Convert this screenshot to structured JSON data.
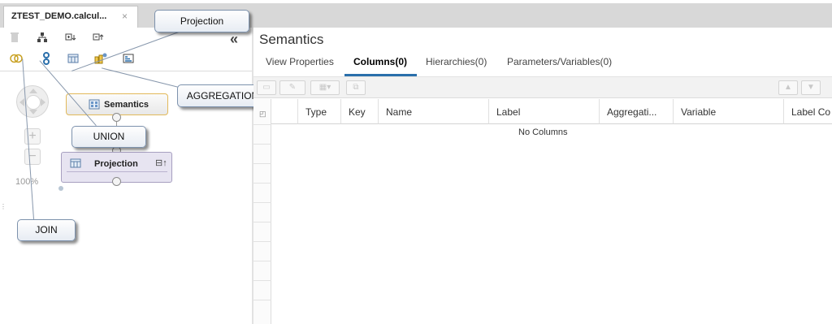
{
  "doc_tab": {
    "title": "ZTEST_DEMO.calcul...",
    "close": "×"
  },
  "left_toolbar": {
    "collapse_label": "«",
    "row1_icons": [
      "trash-icon",
      "auto-layout-icon",
      "expand-icon",
      "collapse-icon"
    ],
    "row2_icons": [
      "join-icon",
      "union-icon",
      "projection-icon",
      "aggregation-icon",
      "rank-icon"
    ]
  },
  "canvas": {
    "zoom_level": "100%",
    "zoom_in": "+",
    "zoom_out": "−",
    "nodes": {
      "semantics": {
        "label": "Semantics"
      },
      "projection": {
        "label": "Projection",
        "collapse": "⊟↑"
      }
    }
  },
  "callouts": {
    "projection": "Projection",
    "aggregation": "AGGREGATION",
    "union": "UNION",
    "join": "JOIN"
  },
  "details": {
    "title": "Semantics",
    "tabs": [
      {
        "label": "View Properties",
        "active": false
      },
      {
        "label": "Columns(0)",
        "active": true
      },
      {
        "label": "Hierarchies(0)",
        "active": false
      },
      {
        "label": "Parameters/Variables(0)",
        "active": false
      }
    ],
    "columns": [
      "Type",
      "Key",
      "Name",
      "Label",
      "Aggregati...",
      "Variable",
      "Label Co"
    ],
    "empty_message": "No Columns"
  },
  "colors": {
    "accent": "#2a6fab",
    "semantics_border": "#e2b95a",
    "projection_fill": "#e7e4f1",
    "callout_border": "#7d92ad"
  }
}
